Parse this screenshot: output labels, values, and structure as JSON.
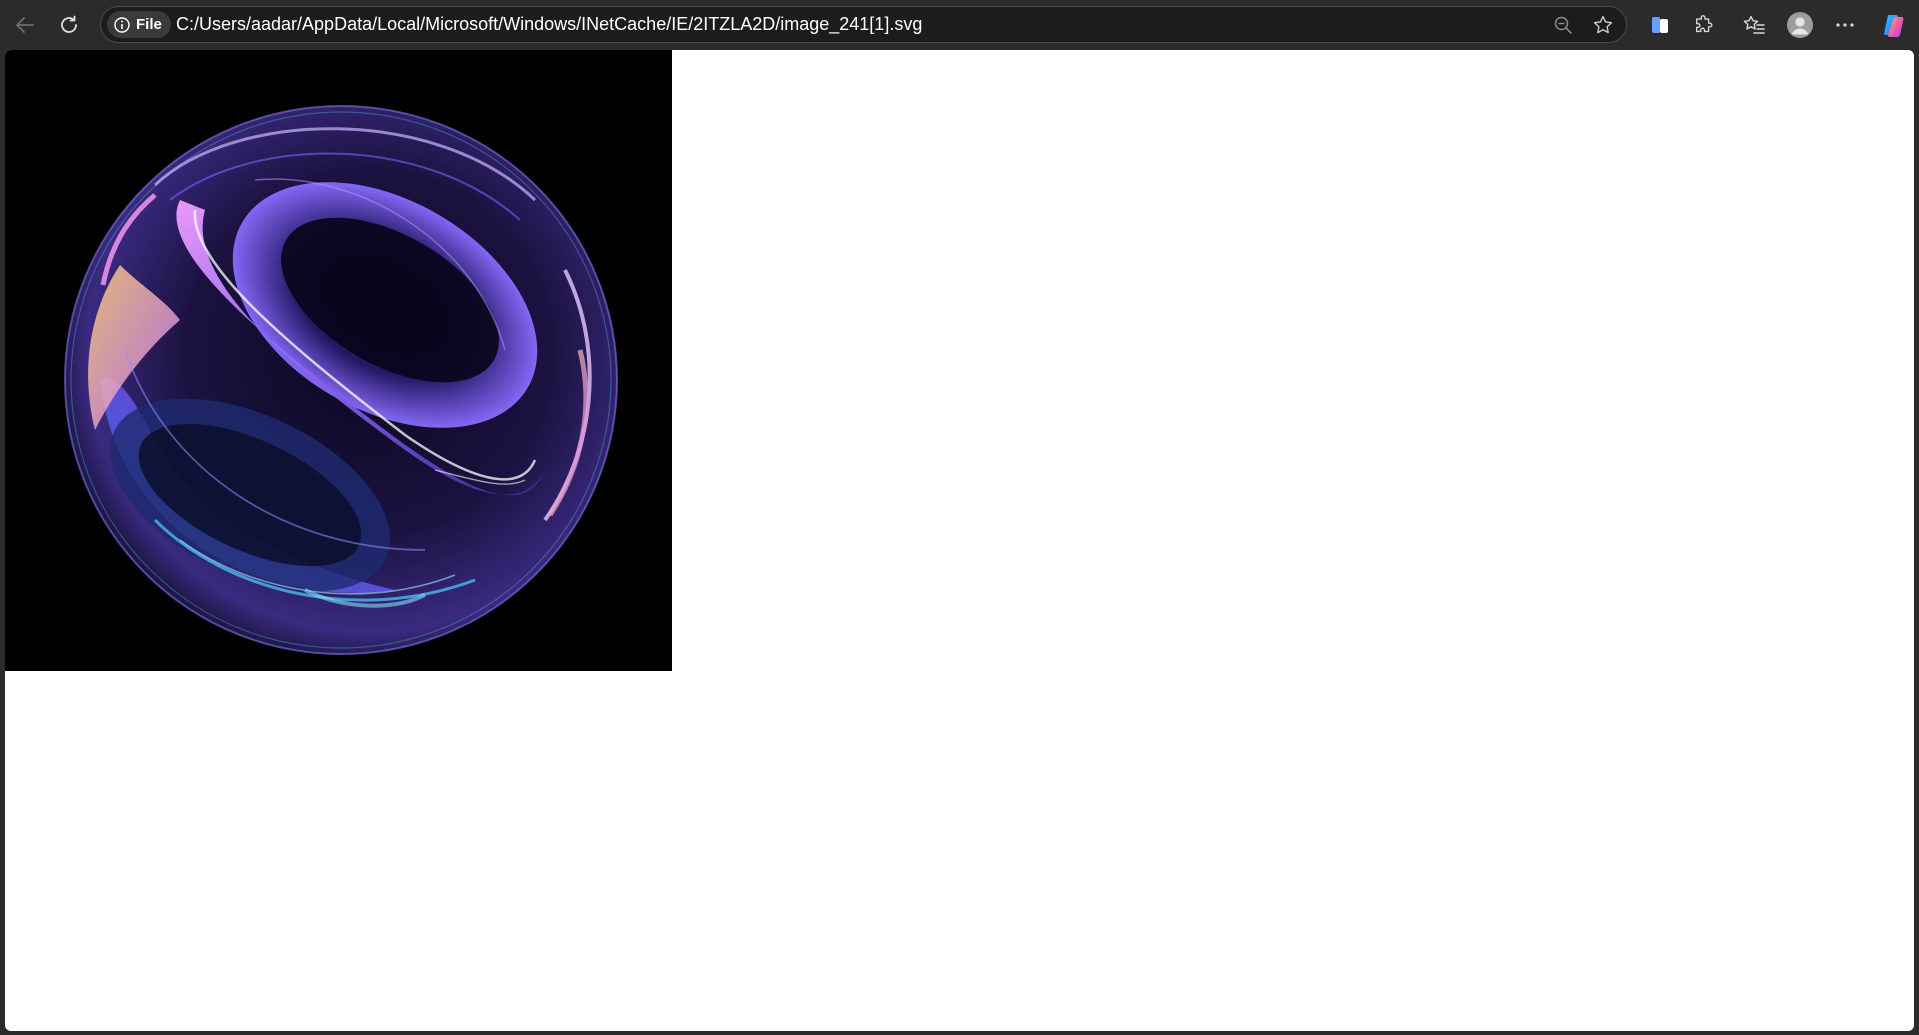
{
  "browser": {
    "address_bar": {
      "site_chip_label": "File",
      "url": "C:/Users/aadar/AppData/Local/Microsoft/Windows/INetCache/IE/2ITZLA2D/image_241[1].svg"
    },
    "icons": {
      "back": "back-arrow-icon",
      "reload": "reload-icon",
      "info": "info-icon",
      "zoom": "zoom-out-icon",
      "favorite": "star-icon",
      "split_screen": "split-screen-icon",
      "extensions": "puzzle-icon",
      "favorites": "favorites-icon",
      "profile": "profile-avatar-icon",
      "more": "more-icon",
      "copilot": "copilot-icon"
    },
    "colors": {
      "chrome_background": "#2b2b2b",
      "address_background": "#1c1c1c",
      "page_background": "#ffffff",
      "image_background": "#000000"
    }
  },
  "content": {
    "image": {
      "description_icon": "glass-sphere-image",
      "palette": [
        "#7b4dff",
        "#c07bff",
        "#4fc3f7",
        "#e8a64a",
        "#1a1040"
      ]
    }
  }
}
